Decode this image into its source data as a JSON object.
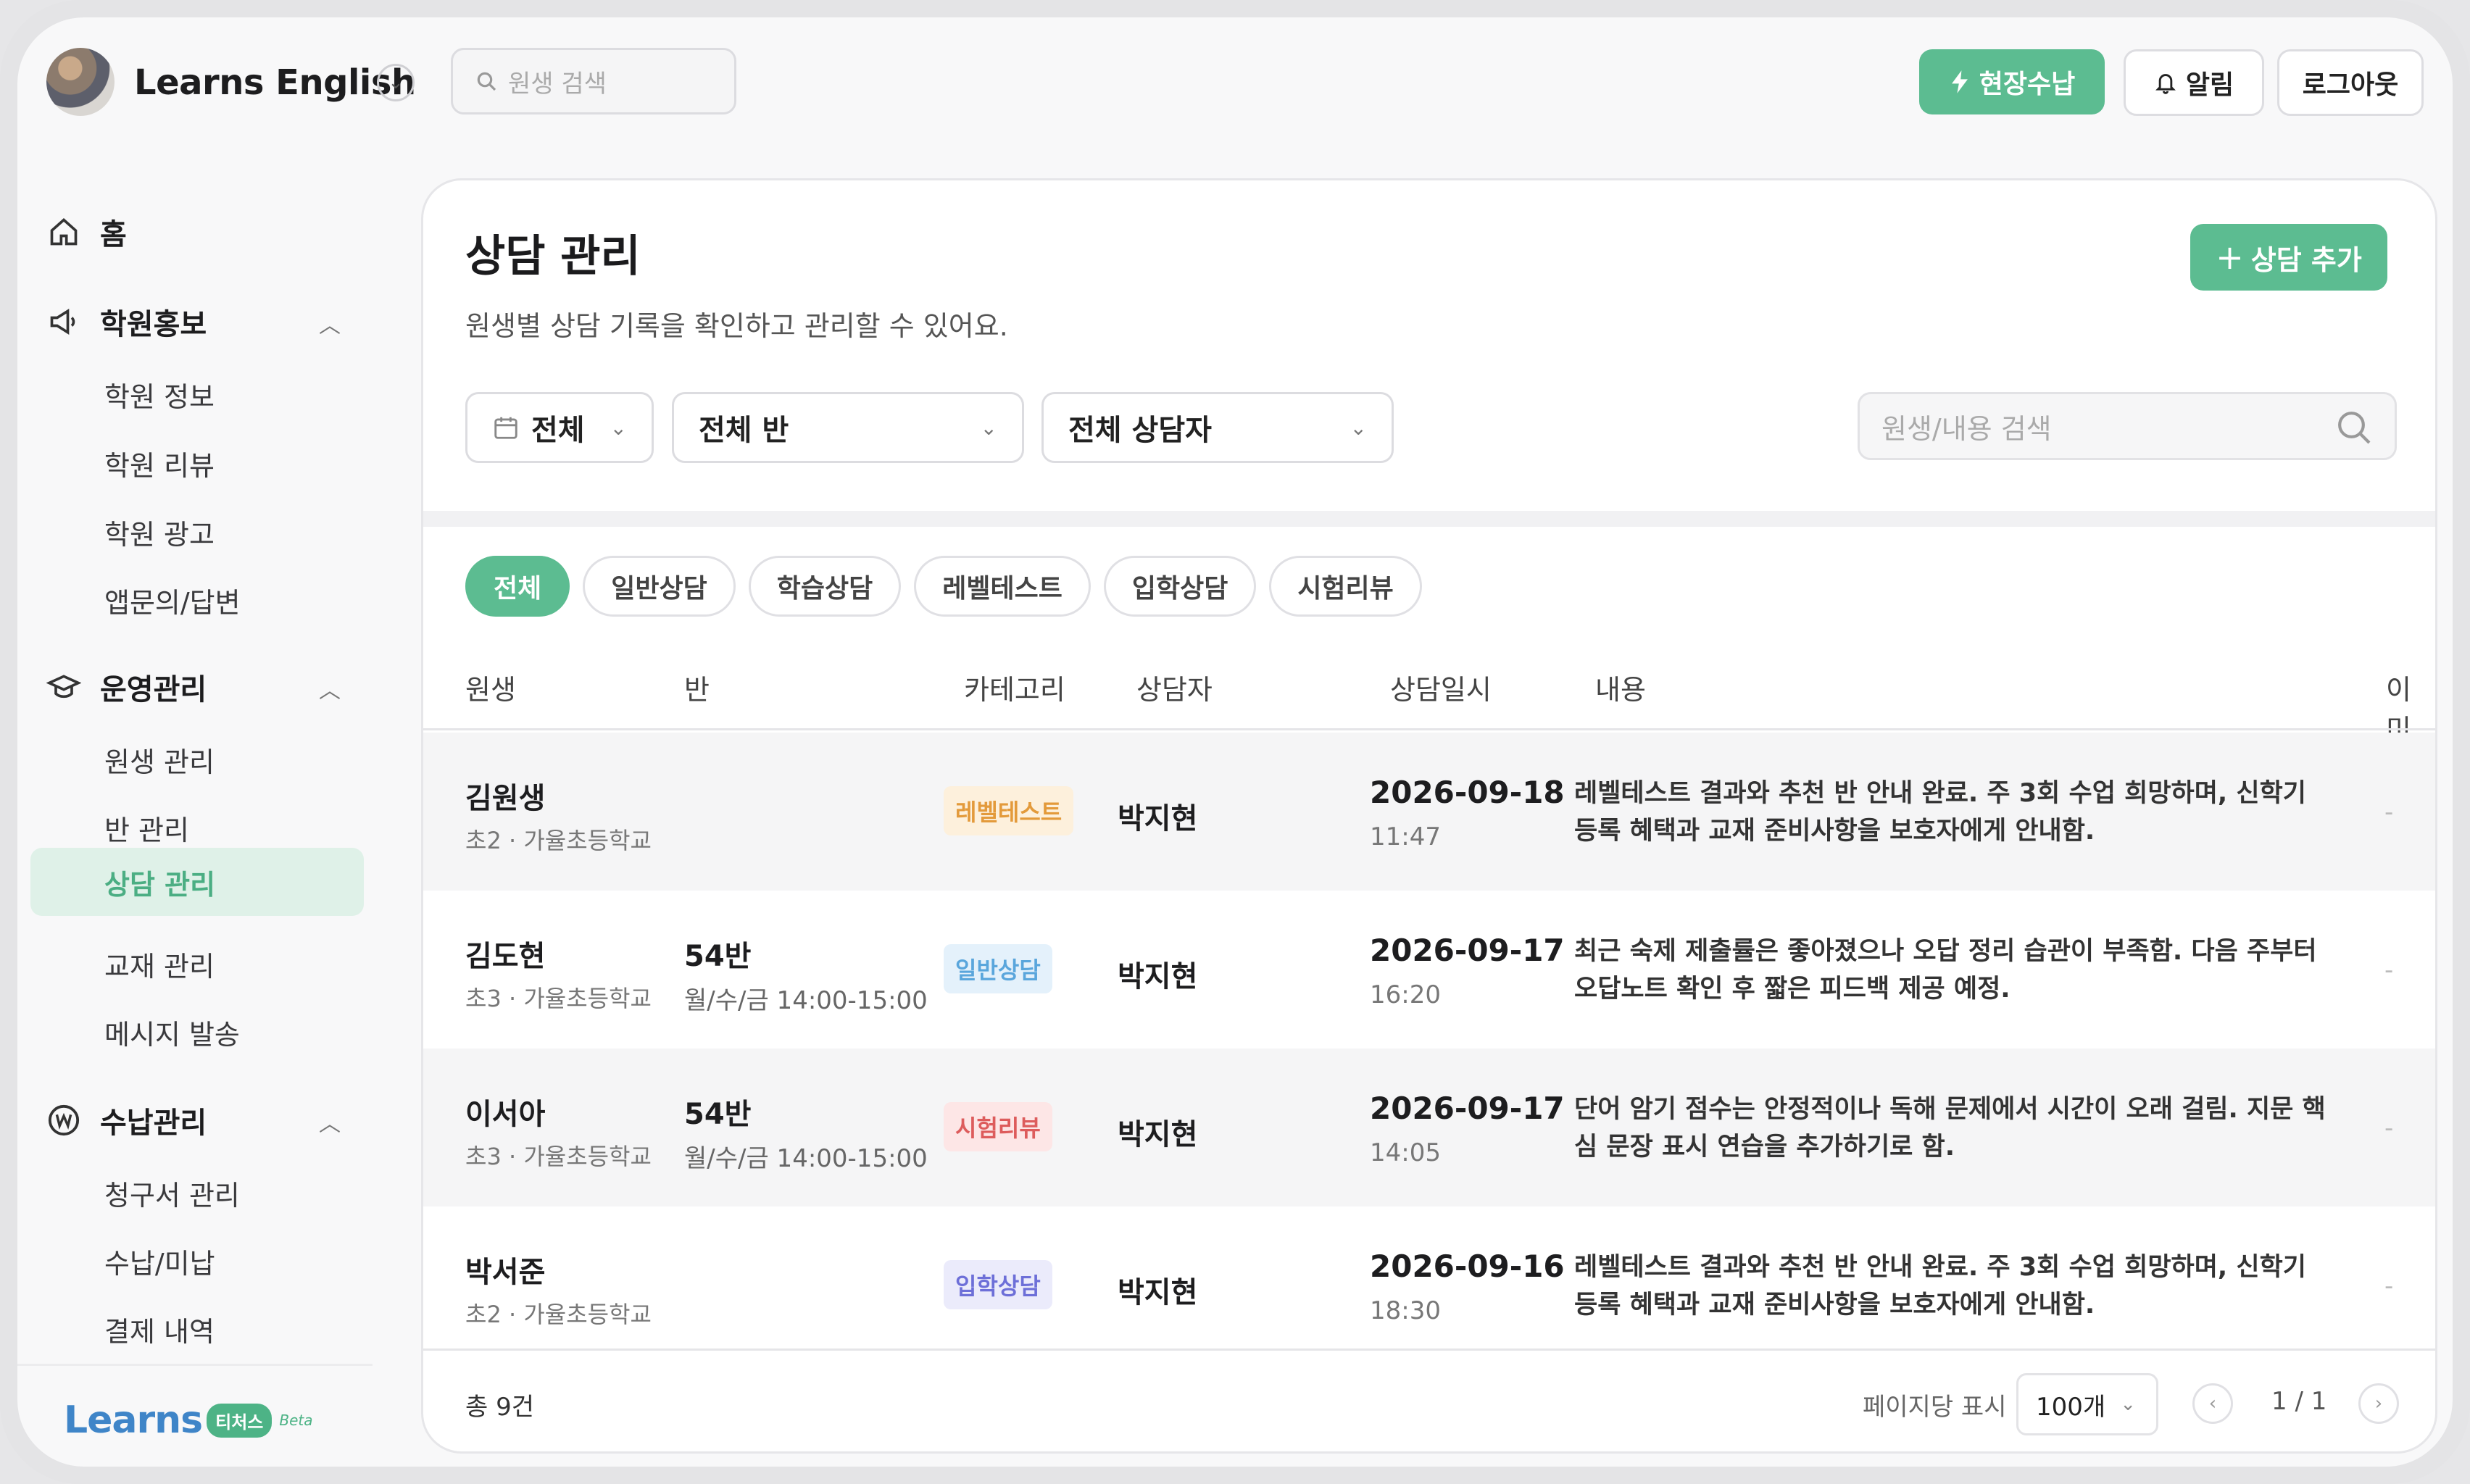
{
  "header": {
    "brand": "Learns English",
    "search_placeholder": "원생 검색",
    "field_payment": "현장수납",
    "alarm": "알림",
    "logout": "로그아웃"
  },
  "sidebar": {
    "home": "홈",
    "groups": [
      {
        "label": "학원홍보",
        "items": [
          "학원 정보",
          "학원 리뷰",
          "학원 광고",
          "앱문의/답변"
        ]
      },
      {
        "label": "운영관리",
        "items": [
          "원생 관리",
          "반 관리",
          "상담 관리",
          "교재 관리",
          "메시지 발송"
        ]
      },
      {
        "label": "수납관리",
        "items": [
          "청구서 관리",
          "수납/미납",
          "결제 내역"
        ]
      }
    ],
    "active_item": "상담 관리",
    "logo": {
      "word": "Learns",
      "pill": "티처스",
      "beta": "Beta"
    }
  },
  "main": {
    "title": "상담 관리",
    "subtitle": "원생별 상담 기록을 확인하고 관리할 수 있어요.",
    "add_button": "상담 추가",
    "filters": {
      "period": "전체",
      "class": "전체 반",
      "counselor": "전체 상담자"
    },
    "content_search_placeholder": "원생/내용 검색",
    "chips": [
      "전체",
      "일반상담",
      "학습상담",
      "레벨테스트",
      "입학상담",
      "시험리뷰"
    ],
    "active_chip": "전체",
    "columns": [
      "원생",
      "반",
      "카테고리",
      "상담자",
      "상담일시",
      "내용",
      "이미지"
    ],
    "rows": [
      {
        "name": "김원생",
        "school": "초2 · 가율초등학교",
        "class": "",
        "time": "",
        "category": "레벨테스트",
        "counselor": "박지현",
        "date": "2026-09-18",
        "hm": "11:47",
        "text": "레벨테스트 결과와 추천 반 안내 완료. 주 3회 수업 희망하며, 신학기 등록 혜택과 교재 준비사항을 보호자에게 안내함.",
        "image": "-"
      },
      {
        "name": "김도현",
        "school": "초3 · 가율초등학교",
        "class": "54반",
        "time": "월/수/금 14:00-15:00",
        "category": "일반상담",
        "counselor": "박지현",
        "date": "2026-09-17",
        "hm": "16:20",
        "text": "최근 숙제 제출률은 좋아졌으나 오답 정리 습관이 부족함. 다음 주부터 오답노트 확인 후 짧은 피드백 제공 예정.",
        "image": "-"
      },
      {
        "name": "이서아",
        "school": "초3 · 가율초등학교",
        "class": "54반",
        "time": "월/수/금 14:00-15:00",
        "category": "시험리뷰",
        "counselor": "박지현",
        "date": "2026-09-17",
        "hm": "14:05",
        "text": "단어 암기 점수는 안정적이나 독해 문제에서 시간이 오래 걸림. 지문 핵심 문장 표시 연습을 추가하기로 함.",
        "image": "-"
      },
      {
        "name": "박서준",
        "school": "초2 · 가율초등학교",
        "class": "",
        "time": "",
        "category": "입학상담",
        "counselor": "박지현",
        "date": "2026-09-16",
        "hm": "18:30",
        "text": "레벨테스트 결과와 추천 반 안내 완료. 주 3회 수업 희망하며, 신학기 등록 혜택과 교재 준비사항을 보호자에게 안내함.",
        "image": "-"
      }
    ],
    "footer": {
      "total": "총 9건",
      "per_page_label": "페이지당 표시",
      "per_page": "100개",
      "page": "1 / 1"
    }
  },
  "colors": {
    "accent": "#5cbc91",
    "tag_level": {
      "bg": "#fdf0dc",
      "fg": "#e39a3b"
    },
    "tag_general": {
      "bg": "#e4f1fb",
      "fg": "#5aa6dc"
    },
    "tag_exam": {
      "bg": "#fde6e6",
      "fg": "#dd5c5c"
    },
    "tag_admission": {
      "bg": "#ebebfb",
      "fg": "#6d6fd8"
    }
  }
}
